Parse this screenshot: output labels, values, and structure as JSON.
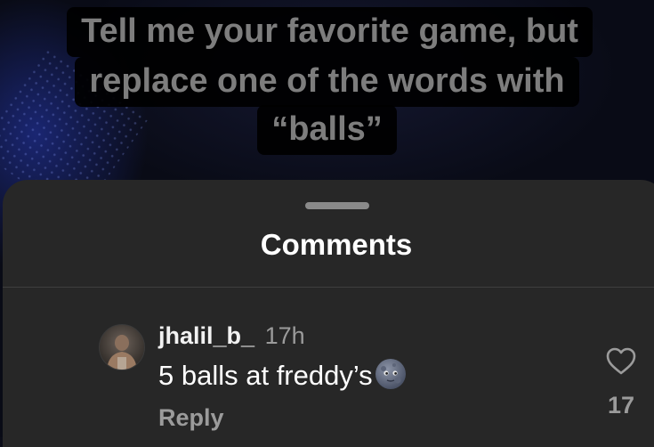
{
  "video": {
    "caption_lines": [
      "Tell me your favorite game, but",
      "replace one of the words with",
      "“balls”"
    ]
  },
  "comments_sheet": {
    "title": "Comments",
    "comments": [
      {
        "username": "jhalil_b_",
        "time": "17h",
        "text": "5 balls at freddy’s",
        "emoji": "new-moon-face",
        "reply_label": "Reply",
        "like_count": "17"
      }
    ]
  },
  "colors": {
    "sheet_background": "#272727",
    "caption_text": "#7d7d7d",
    "secondary_text": "#9b9b9b"
  }
}
